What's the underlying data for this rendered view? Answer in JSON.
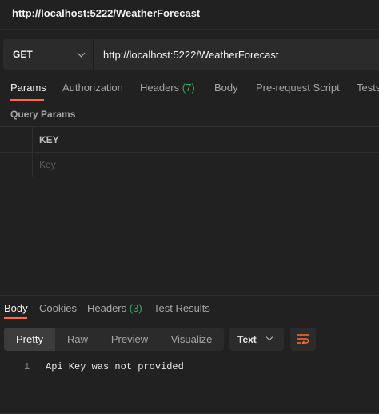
{
  "window": {
    "title": "http://localhost:5222/WeatherForecast"
  },
  "request": {
    "method": "GET",
    "url": "http://localhost:5222/WeatherForecast"
  },
  "request_tabs": {
    "params": "Params",
    "authorization": "Authorization",
    "headers": "Headers",
    "headers_count": "(7)",
    "body": "Body",
    "pre_request_script": "Pre-request Script",
    "tests": "Tests"
  },
  "query_params": {
    "section_label": "Query Params",
    "key_header": "KEY",
    "key_placeholder": "Key"
  },
  "response_tabs": {
    "body": "Body",
    "cookies": "Cookies",
    "headers": "Headers",
    "headers_count": "(3)",
    "test_results": "Test Results"
  },
  "response_view": {
    "pretty": "Pretty",
    "raw": "Raw",
    "preview": "Preview",
    "visualize": "Visualize",
    "format": "Text",
    "wrap_icon": "wrap-lines-icon"
  },
  "response_body": {
    "line_number": "1",
    "text": "Api Key was not provided"
  },
  "colors": {
    "accent": "#ff6c37",
    "count_green": "#2fae5b",
    "background": "#212121"
  }
}
